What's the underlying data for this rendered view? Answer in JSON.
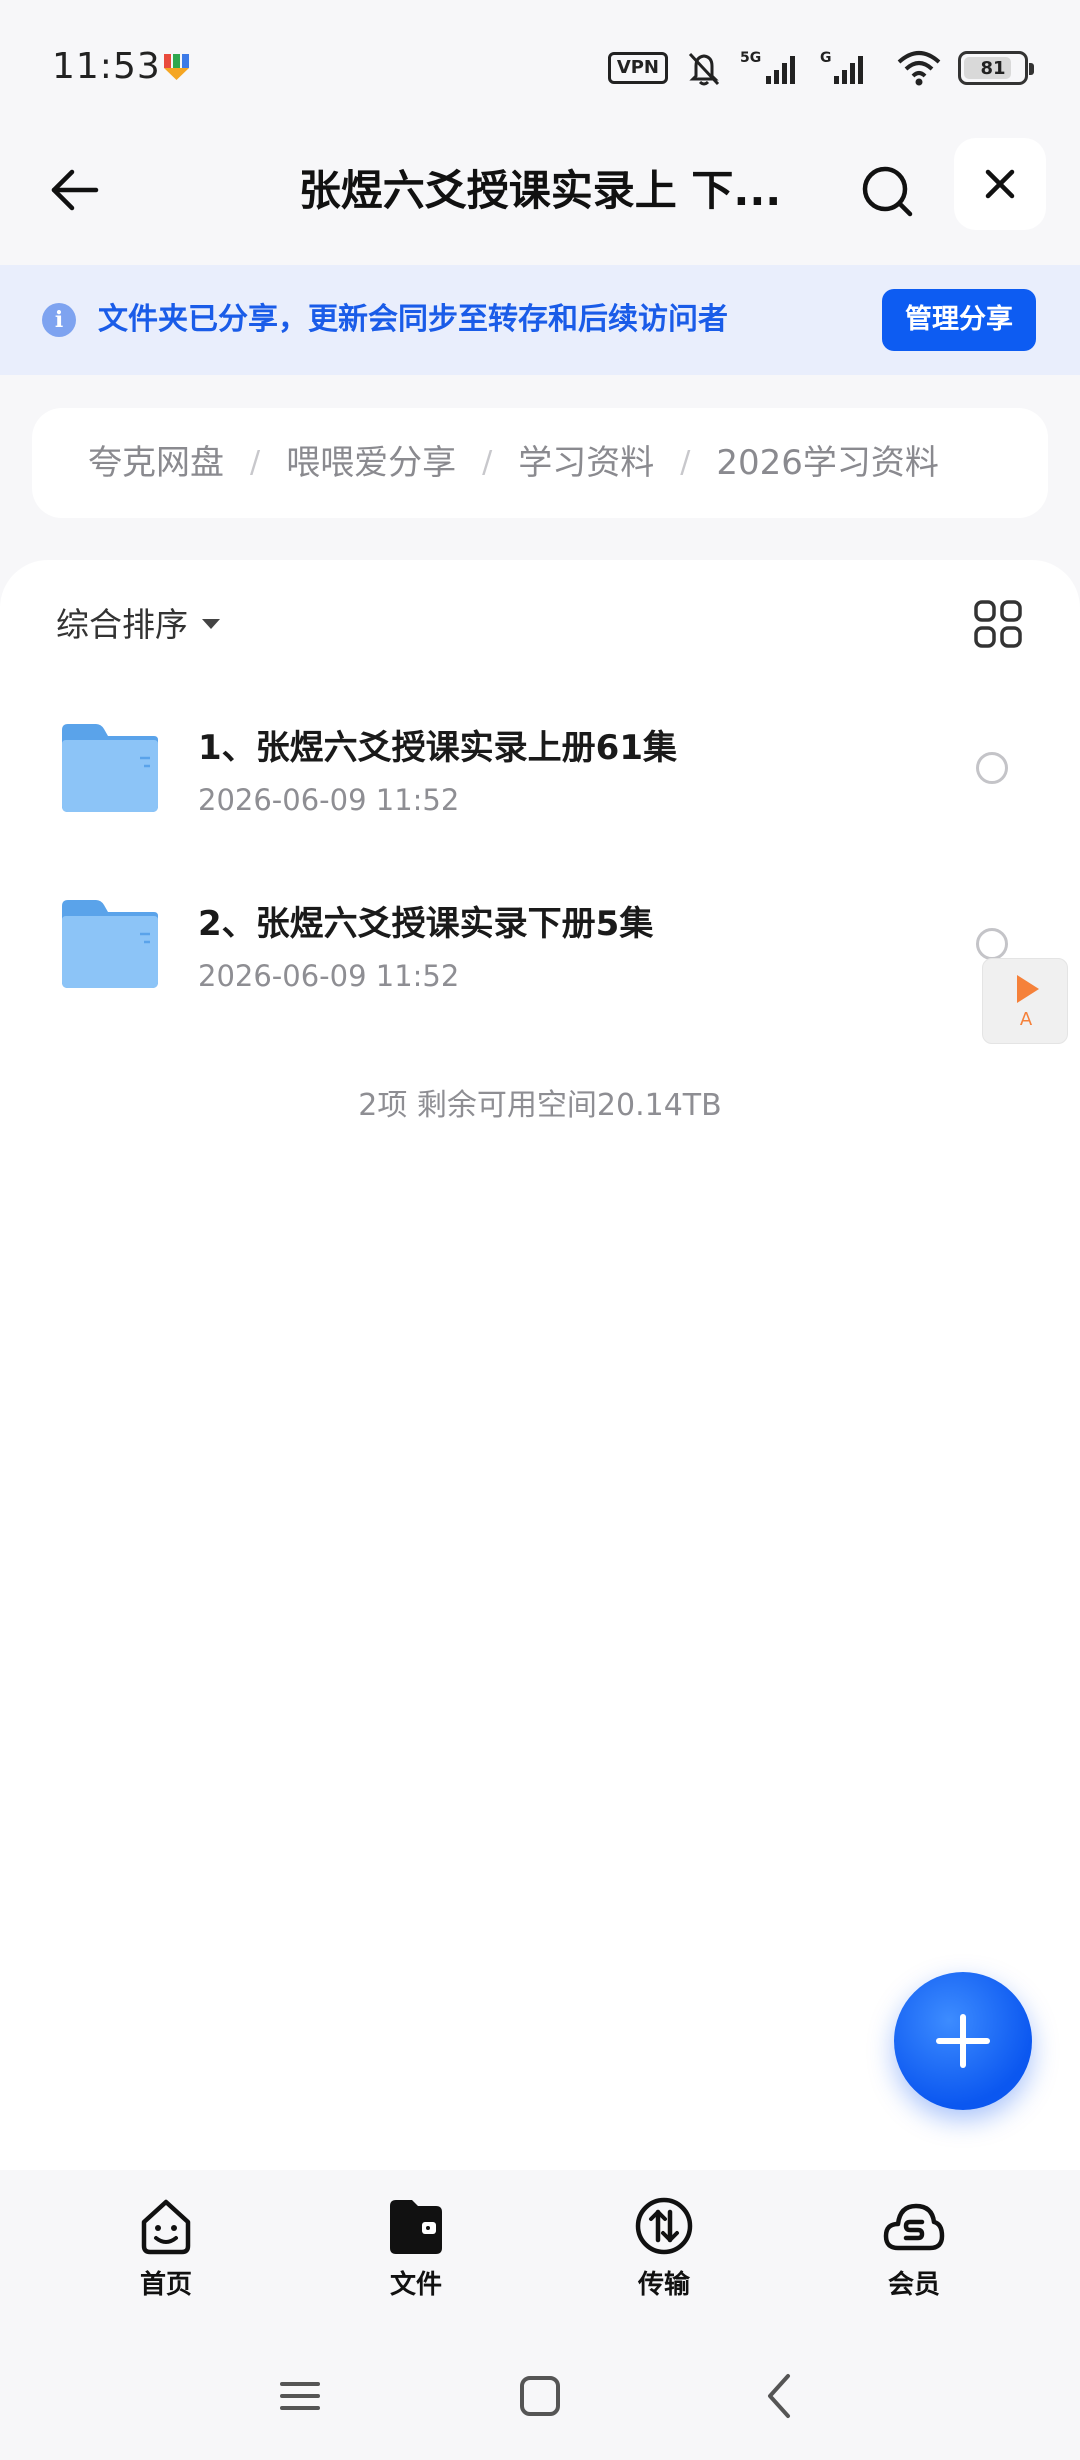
{
  "status_bar": {
    "time": "11:53",
    "vpn_label": "VPN",
    "network_5g": "5G",
    "network_g": "G",
    "battery_level": "81",
    "battery_fraction": 0.81
  },
  "header": {
    "title": "张煜六爻授课实录上 下...",
    "back_icon": "arrow-left-icon",
    "search_icon": "search-icon",
    "close_icon": "close-icon"
  },
  "share_banner": {
    "message": "文件夹已分享，更新会同步至转存和后续访问者",
    "manage_label": "管理分享"
  },
  "breadcrumb": {
    "items": [
      "夸克网盘",
      "喂喂爱分享",
      "学习资料",
      "2026学习资料"
    ],
    "separator": "/"
  },
  "toolbar": {
    "sort_label": "综合排序",
    "view_toggle_icon": "grid-view-icon"
  },
  "files": [
    {
      "name": "1、张煜六爻授课实录上册61集",
      "date": "2026-06-09 11:52"
    },
    {
      "name": "2、张煜六爻授课实录下册5集",
      "date": "2026-06-09 11:52"
    }
  ],
  "summary": "2项 剩余可用空间20.14TB",
  "floating_widget": {
    "letter": "A"
  },
  "bottom_nav": [
    {
      "label": "首页",
      "icon": "home-face-icon"
    },
    {
      "label": "文件",
      "icon": "folder-wallet-icon"
    },
    {
      "label": "传输",
      "icon": "transfer-icon"
    },
    {
      "label": "会员",
      "icon": "member-cloud-icon"
    }
  ],
  "colors": {
    "accent": "#0d5cf2",
    "banner_bg": "#e9eefc",
    "banner_text": "#1a5ce8",
    "folder": "#6fb1f2"
  }
}
